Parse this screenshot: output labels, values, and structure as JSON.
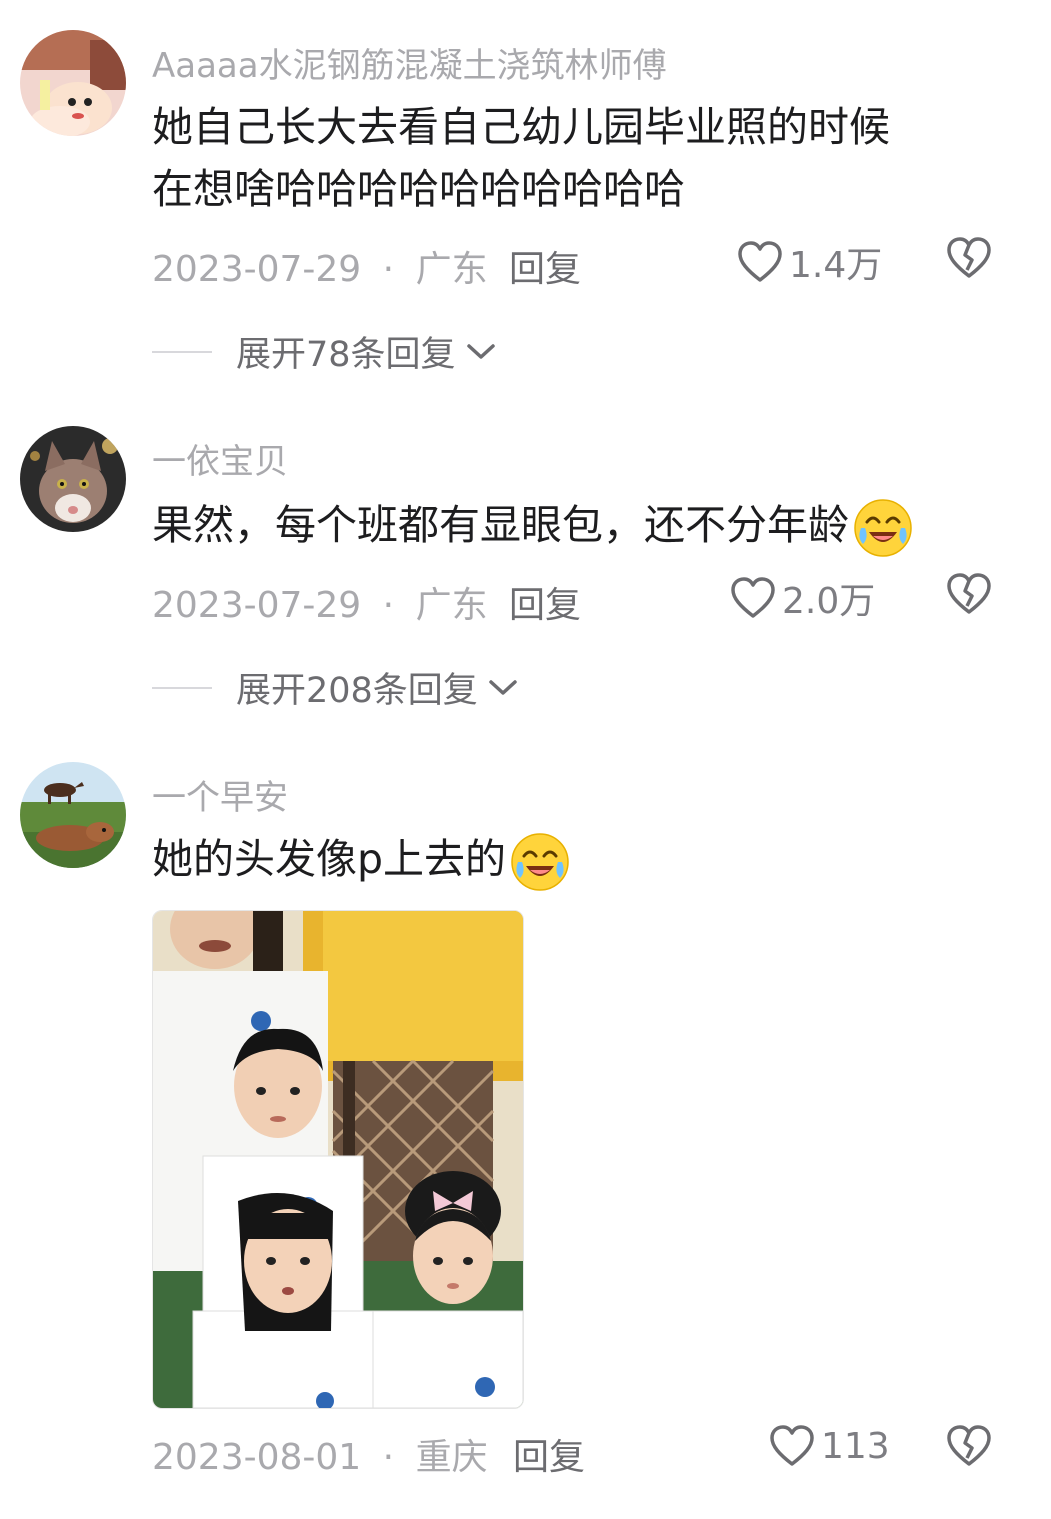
{
  "comments": [
    {
      "username": "Aaaaa水泥钢筋混凝土浇筑林师傅",
      "text_lines": [
        "她自己长大去看自己幼儿园毕业照的时候",
        "在想啥哈哈哈哈哈哈哈哈哈哈"
      ],
      "date": "2023-07-29",
      "location": "广东",
      "reply_label": "回复",
      "likes": "1.4万",
      "expand_label": "展开78条回复"
    },
    {
      "username": "一依宝贝",
      "text": "果然，每个班都有显眼包，还不分年龄",
      "date": "2023-07-29",
      "location": "广东",
      "reply_label": "回复",
      "likes": "2.0万",
      "expand_label": "展开208条回复"
    },
    {
      "username": "一个早安",
      "text": "她的头发像p上去的",
      "date": "2023-08-01",
      "location": "重庆",
      "reply_label": "回复",
      "likes": "113"
    }
  ],
  "meta_separator": "·",
  "icons": {
    "like": "heart-outline-icon",
    "dislike": "broken-heart-icon",
    "expand": "chevron-down-icon",
    "emoji": "crying-laughing-emoji-icon"
  },
  "colors": {
    "username": "#a9a9ad",
    "text": "#1d1d1f",
    "meta": "#a9a9ad"
  }
}
